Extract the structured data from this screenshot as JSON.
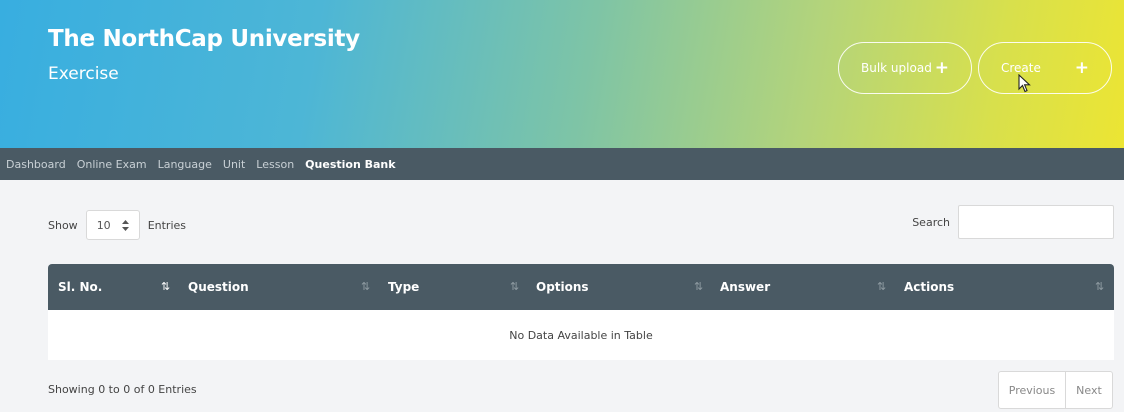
{
  "header": {
    "title": "The NorthCap University",
    "subtitle": "Exercise",
    "bulk_upload_label": "Bulk upload",
    "create_label": "Create",
    "plus_glyph": "+"
  },
  "nav": {
    "items": [
      {
        "label": "Dashboard"
      },
      {
        "label": "Online Exam"
      },
      {
        "label": "Language"
      },
      {
        "label": "Unit"
      },
      {
        "label": "Lesson"
      },
      {
        "label": "Question Bank",
        "active": true
      }
    ]
  },
  "controls": {
    "show_label": "Show",
    "entries_value": "10",
    "entries_label": "Entries",
    "search_label": "Search",
    "search_value": ""
  },
  "table": {
    "columns": [
      "Sl. No.",
      "Question",
      "Type",
      "Options",
      "Answer",
      "Actions"
    ],
    "empty_message": "No Data Available in Table",
    "rows": []
  },
  "footer": {
    "info": "Showing 0 to 0 of 0 Entries",
    "previous_label": "Previous",
    "next_label": "Next"
  },
  "colors": {
    "navbar": "#4a5a64",
    "table_header": "#4a5a64",
    "gradient_start": "#38aee0",
    "gradient_end": "#ece533"
  },
  "icons": {
    "sort": "sort-arrows-icon",
    "select": "select-arrows-icon",
    "cursor": "mouse-pointer-icon"
  }
}
